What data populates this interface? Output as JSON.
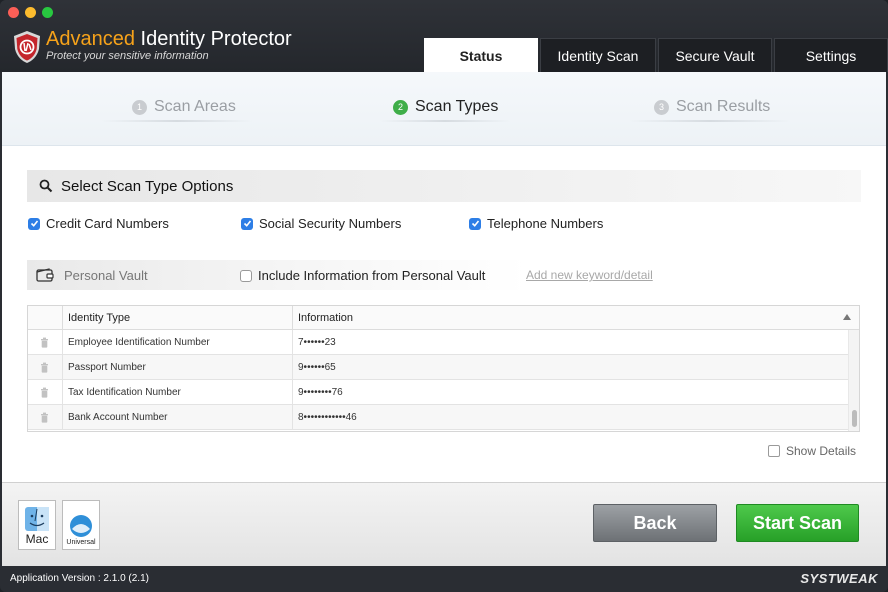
{
  "app": {
    "name_accent": "Advanced",
    "name_rest": " Identity Protector",
    "tagline": "Protect your sensitive information"
  },
  "tabs": [
    {
      "label": "Status",
      "active": true
    },
    {
      "label": "Identity Scan",
      "active": false
    },
    {
      "label": "Secure Vault",
      "active": false
    },
    {
      "label": "Settings",
      "active": false
    }
  ],
  "steps": [
    {
      "num": "1",
      "label": "Scan Areas",
      "active": false
    },
    {
      "num": "2",
      "label": "Scan Types",
      "active": true
    },
    {
      "num": "3",
      "label": "Scan Results",
      "active": false
    }
  ],
  "section_title": "Select Scan Type Options",
  "scan_types": [
    {
      "label": "Credit Card Numbers",
      "checked": true
    },
    {
      "label": "Social Security Numbers",
      "checked": true
    },
    {
      "label": "Telephone Numbers",
      "checked": true
    }
  ],
  "vault": {
    "label": "Personal Vault",
    "include_label": "Include Information from Personal Vault",
    "include_checked": false,
    "add_link": "Add new keyword/detail"
  },
  "table": {
    "columns": [
      "Identity Type",
      "Information"
    ],
    "rows": [
      {
        "type": "Employee Identification Number",
        "info": "7••••••23"
      },
      {
        "type": "Passport Number",
        "info": "9••••••65"
      },
      {
        "type": "Tax Identification Number",
        "info": "9••••••••76"
      },
      {
        "type": "Bank Account Number",
        "info": "8••••••••••••46"
      }
    ]
  },
  "show_details": {
    "label": "Show Details",
    "checked": false
  },
  "badges": {
    "mac": "Mac",
    "universal": "Universal"
  },
  "buttons": {
    "back": "Back",
    "start": "Start Scan"
  },
  "status": {
    "version": "Application Version : 2.1.0 (2.1)",
    "vendor": "SYSTWEAK"
  },
  "colors": {
    "accent_orange": "#f6a21a",
    "active_step": "#3fae49",
    "checkbox_blue": "#2d7ee6",
    "start_green": "#27a028"
  }
}
